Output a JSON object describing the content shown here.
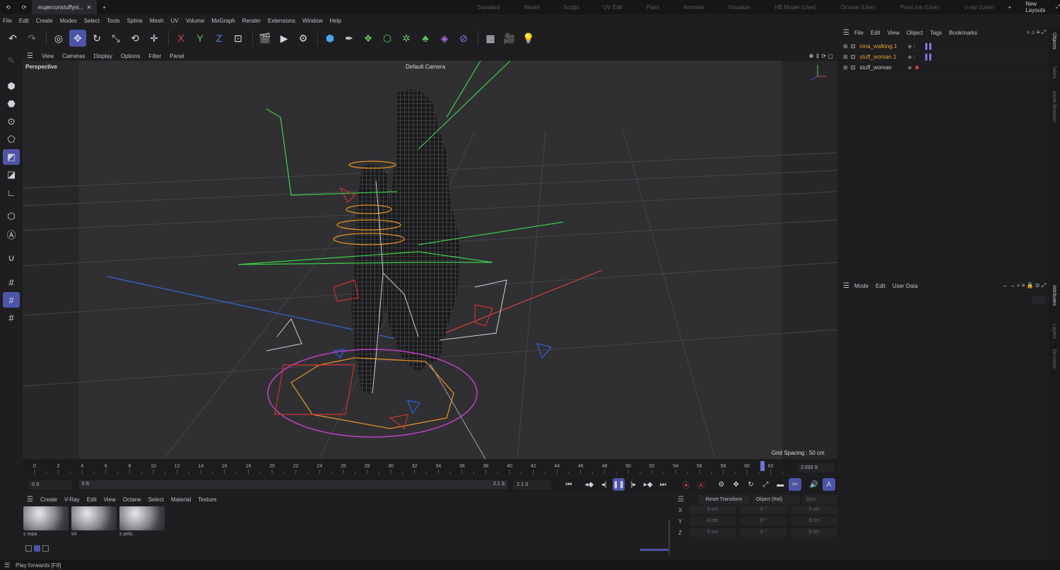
{
  "topbar": {
    "file_tab": "mujerconstuffyni...",
    "layouts": [
      "Standard",
      "Model",
      "Sculpt",
      "UV Edit",
      "Paint",
      "Animate",
      "Visualize",
      "HB Model (User)",
      "Octane (User)",
      "Paint ron (User)",
      "V-ray (User)"
    ],
    "new_layouts": "New Layouts"
  },
  "menu": [
    "File",
    "Edit",
    "Create",
    "Modes",
    "Select",
    "Tools",
    "Spline",
    "Mesh",
    "UV",
    "Volume",
    "MoGraph",
    "Render",
    "Extensions",
    "Window",
    "Help"
  ],
  "toolbar": {
    "axis_x": "X",
    "axis_y": "Y",
    "axis_z": "Z"
  },
  "viewport": {
    "menu": [
      "View",
      "Cameras",
      "Display",
      "Options",
      "Filter",
      "Panel"
    ],
    "label": "Perspective",
    "camera": "Default Camera",
    "grid_spacing": "Grid Spacing : 50 cm"
  },
  "timeline": {
    "ticks": [
      "0",
      "2",
      "4",
      "6",
      "8",
      "10",
      "12",
      "14",
      "16",
      "18",
      "20",
      "22",
      "24",
      "26",
      "28",
      "30",
      "32",
      "34",
      "36",
      "38",
      "40",
      "42",
      "44",
      "46",
      "48",
      "50",
      "52",
      "54",
      "56",
      "58",
      "60",
      "62"
    ],
    "current_time": "2.033 S",
    "start": "0 S",
    "range_start": "0 S",
    "range_end": "2.1 S",
    "end": "2.1 S"
  },
  "materials": {
    "menu": [
      "Create",
      "V-Ray",
      "Edit",
      "View",
      "Octane",
      "Select",
      "Material",
      "Texture"
    ],
    "items": [
      {
        "name": "s ropa"
      },
      {
        "name": "s4"
      },
      {
        "name": "s pelo"
      }
    ]
  },
  "coords": {
    "reset": "Reset Transform",
    "mode": "Object (Rel)",
    "size": "Size",
    "rows": [
      {
        "axis": "X",
        "pos": "0 cm",
        "rot": "0 °",
        "scale": "0 cm"
      },
      {
        "axis": "Y",
        "pos": "0 cm",
        "rot": "0 °",
        "scale": "0 cm"
      },
      {
        "axis": "Z",
        "pos": "0 cm",
        "rot": "0 °",
        "scale": "0 cm"
      }
    ]
  },
  "objects": {
    "menu": [
      "File",
      "Edit",
      "View",
      "Object",
      "Tags",
      "Bookmarks"
    ],
    "items": [
      {
        "name": "nina_walking.1",
        "color": "#e0a030"
      },
      {
        "name": "stuff_woman.1",
        "color": "#e0a030"
      },
      {
        "name": "stuff_woman",
        "color": "#c8c8cc"
      }
    ]
  },
  "attributes": {
    "menu": [
      "Mode",
      "Edit",
      "User Data"
    ]
  },
  "side_tabs": [
    "Objects",
    "Takes",
    "Asset Browser",
    "Attributes",
    "Layers",
    "Structure"
  ],
  "status": "Play forwards [F8]"
}
